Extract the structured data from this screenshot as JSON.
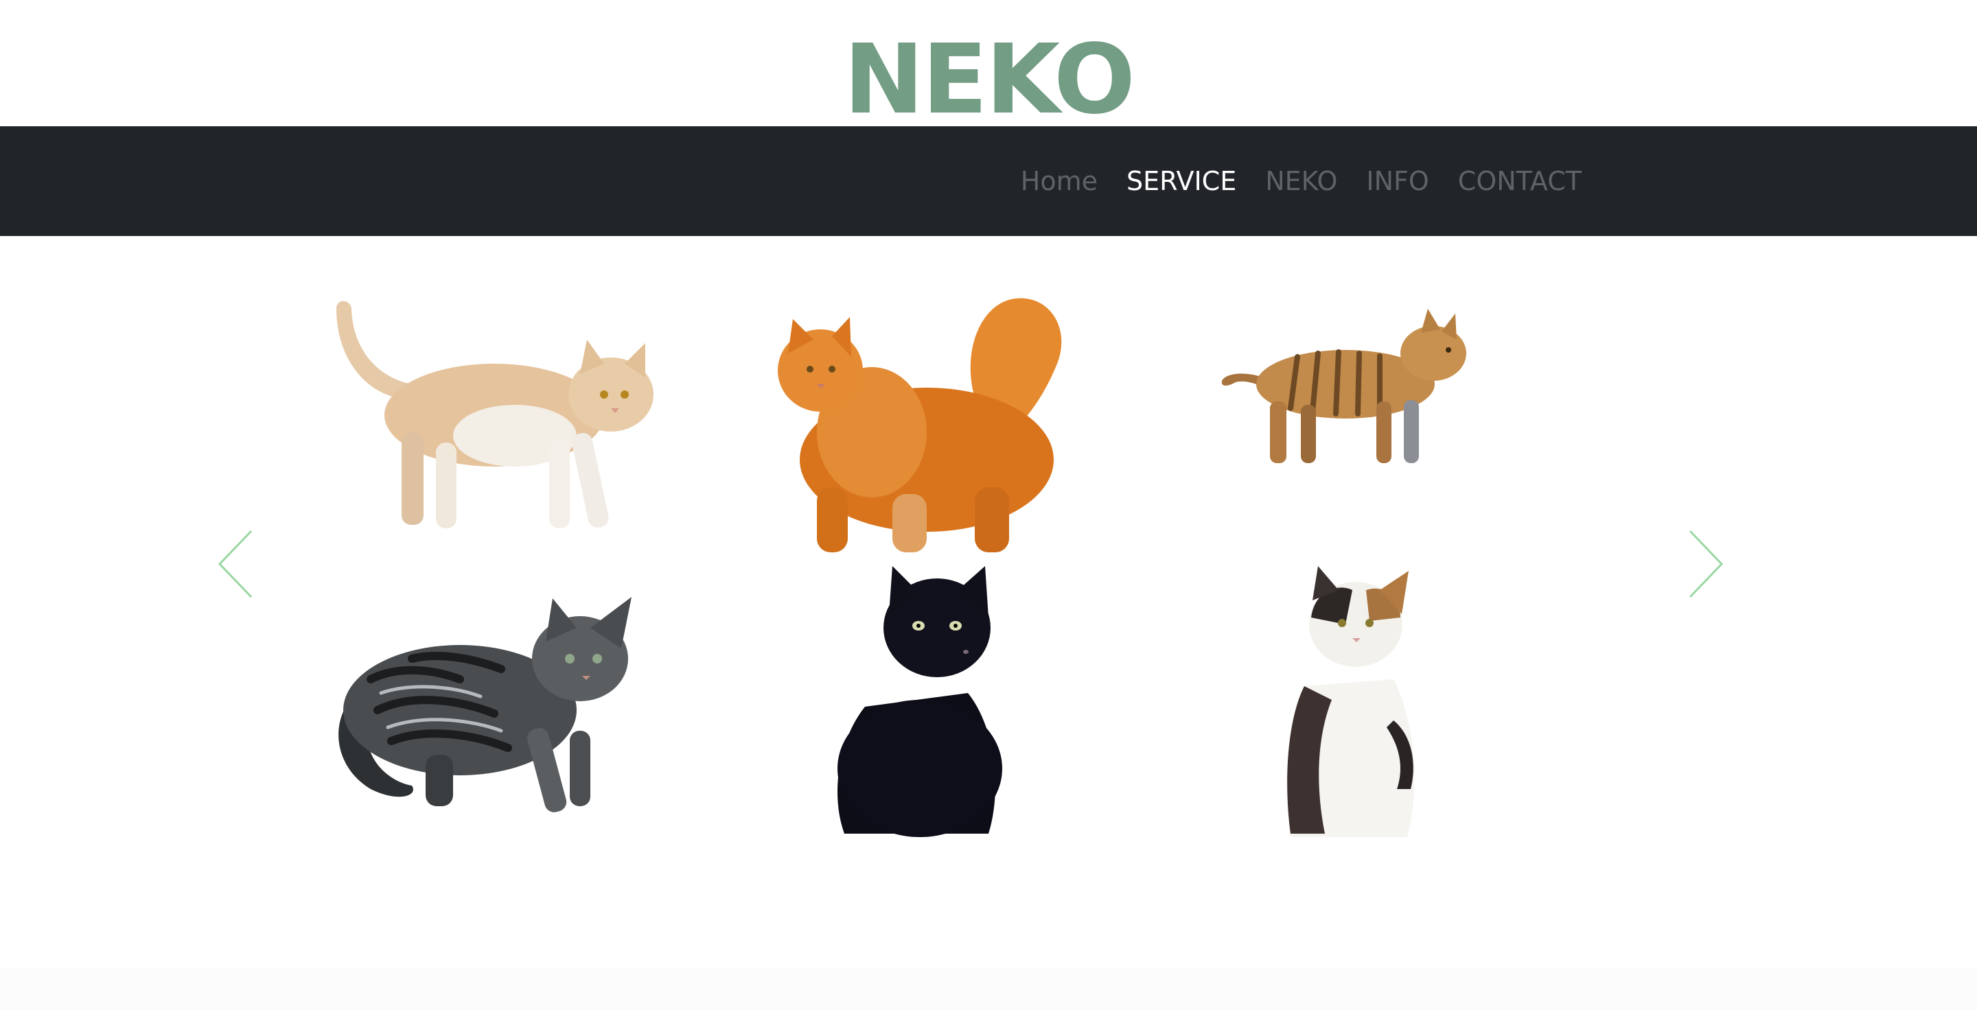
{
  "header": {
    "logo_text": "NEKO",
    "logo_color": "#739d84"
  },
  "nav": {
    "background": "#212529",
    "items": [
      {
        "label": "Home",
        "active": false
      },
      {
        "label": "SERVICE",
        "active": true
      },
      {
        "label": "NEKO",
        "active": false
      },
      {
        "label": "INFO",
        "active": false
      },
      {
        "label": "CONTACT",
        "active": false
      }
    ]
  },
  "carousel": {
    "arrow_color": "#9ad7a2",
    "prev_icon": "chevron-left-icon",
    "next_icon": "chevron-right-icon",
    "images": [
      {
        "name": "cream-tabby-cat"
      },
      {
        "name": "orange-longhair-cat"
      },
      {
        "name": "striped-tabby-cat"
      },
      {
        "name": "silver-tabby-cat"
      },
      {
        "name": "black-cat"
      },
      {
        "name": "calico-cat"
      }
    ]
  }
}
